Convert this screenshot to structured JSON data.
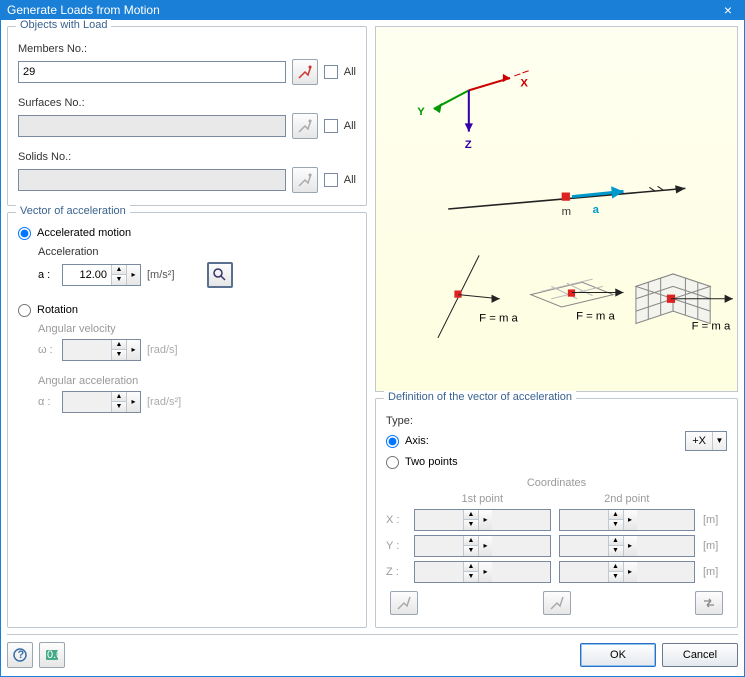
{
  "window": {
    "title": "Generate Loads from Motion"
  },
  "objects": {
    "group_title": "Objects with Load",
    "members_label": "Members No.:",
    "members_value": "29",
    "surfaces_label": "Surfaces No.:",
    "surfaces_value": "",
    "solids_label": "Solids No.:",
    "solids_value": "",
    "all_label": "All"
  },
  "vector": {
    "group_title": "Vector of acceleration",
    "accel_motion_label": "Accelerated motion",
    "acceleration_label": "Acceleration",
    "a_prefix": "a :",
    "a_value": "12.00",
    "a_unit": "[m/s²]",
    "rotation_label": "Rotation",
    "ang_vel_label": "Angular velocity",
    "omega_prefix": "ω :",
    "omega_value": "",
    "omega_unit": "[rad/s]",
    "ang_acc_label": "Angular acceleration",
    "alpha_prefix": "α :",
    "alpha_value": "",
    "alpha_unit": "[rad/s²]"
  },
  "preview": {
    "x": "X",
    "y": "Y",
    "z": "Z",
    "m": "m",
    "a": "a",
    "formula": "F = m a"
  },
  "definition": {
    "group_title": "Definition of the vector of acceleration",
    "type_label": "Type:",
    "axis_label": "Axis:",
    "axis_value": "+X",
    "twopoints_label": "Two points",
    "coordinates_label": "Coordinates",
    "first_point": "1st point",
    "second_point": "2nd point",
    "x_lbl": "X :",
    "y_lbl": "Y :",
    "z_lbl": "Z :",
    "unit_m": "[m]",
    "x1": "",
    "y1": "",
    "z1": "",
    "x2": "",
    "y2": "",
    "z2": ""
  },
  "footer": {
    "ok": "OK",
    "cancel": "Cancel"
  }
}
